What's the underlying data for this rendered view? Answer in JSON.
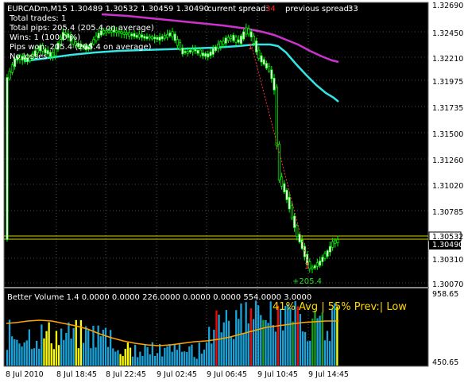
{
  "header": {
    "symbol": "EURCADm,M15",
    "ohlc": "1.30489 1.30532 1.30459 1.30490",
    "current_spread_label": "current spread:",
    "current_spread_value": "34",
    "previous_spread_label": "previous spread:",
    "previous_spread_value": "33",
    "stats": [
      "Total trades: 1",
      "Total pips: 205.4 (205.4 on average)",
      "Wins: 1 (100.0 %)",
      "Pips won: 205.4 (205.4 on average)",
      "No losses"
    ]
  },
  "price_axis": {
    "ticks": [
      "1.32690",
      "1.32450",
      "1.32210",
      "1.31975",
      "1.31735",
      "1.31500",
      "1.31260",
      "1.31020",
      "1.30785",
      "1.30310",
      "1.30070"
    ],
    "current_price": "1.30490",
    "line_price": "1.30532"
  },
  "trade_labels": {
    "entry_marker": "1",
    "profit": "+205.4"
  },
  "volume": {
    "title": "Better Volume 1.4 0.0000 0.0000 226.0000 0.0000 0.0000 554.0000 3.0000",
    "summary": "41% Avg | 55% Prev:| Low",
    "axis_top": "958.65",
    "axis_bottom": "450.65"
  },
  "time_axis": [
    "8 Jul 2010",
    "8 Jul 18:45",
    "8 Jul 22:45",
    "9 Jul 02:45",
    "9 Jul 06:45",
    "9 Jul 10:45",
    "9 Jul 14:45"
  ],
  "colors": {
    "background": "#000000",
    "grid": "#8a8a8a",
    "candle": "#00ff00",
    "magenta_ma": "#cc33cc",
    "cyan_ma": "#33e6e6",
    "price_line": "#d4d400",
    "vol_blue": "#1aa3d9",
    "vol_yellow": "#ffff00",
    "vol_red": "#ff0000",
    "vol_green": "#1f9f1f",
    "vol_avg": "#ffa500",
    "summary_text": "#ffd700"
  }
}
